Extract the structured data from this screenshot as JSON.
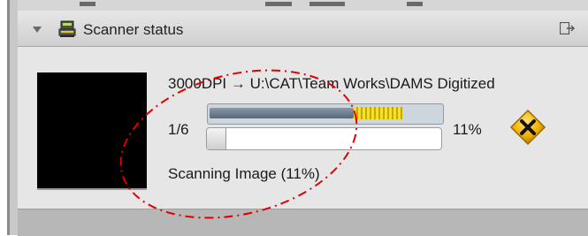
{
  "panel": {
    "title": "Scanner status",
    "title_icon": "scanner-icon",
    "collapse_icon": "chevron-down-icon",
    "undock_icon": "undock-icon"
  },
  "scan": {
    "destination": "3000DPI → U:\\CAT\\Team Works\\DAMS Digitized",
    "page_counter": "1/6",
    "current_page_progress": 0.85,
    "overall_progress": 0.08,
    "percent_label": "11%",
    "status": "Scanning Image (11%)",
    "cancel_icon": "cancel-x-icon"
  },
  "colors": {
    "progress_fill": "#566878",
    "progress_stripes": "#f5e12a",
    "cancel_badge": "#f2b300",
    "annotation": "#e00000"
  }
}
